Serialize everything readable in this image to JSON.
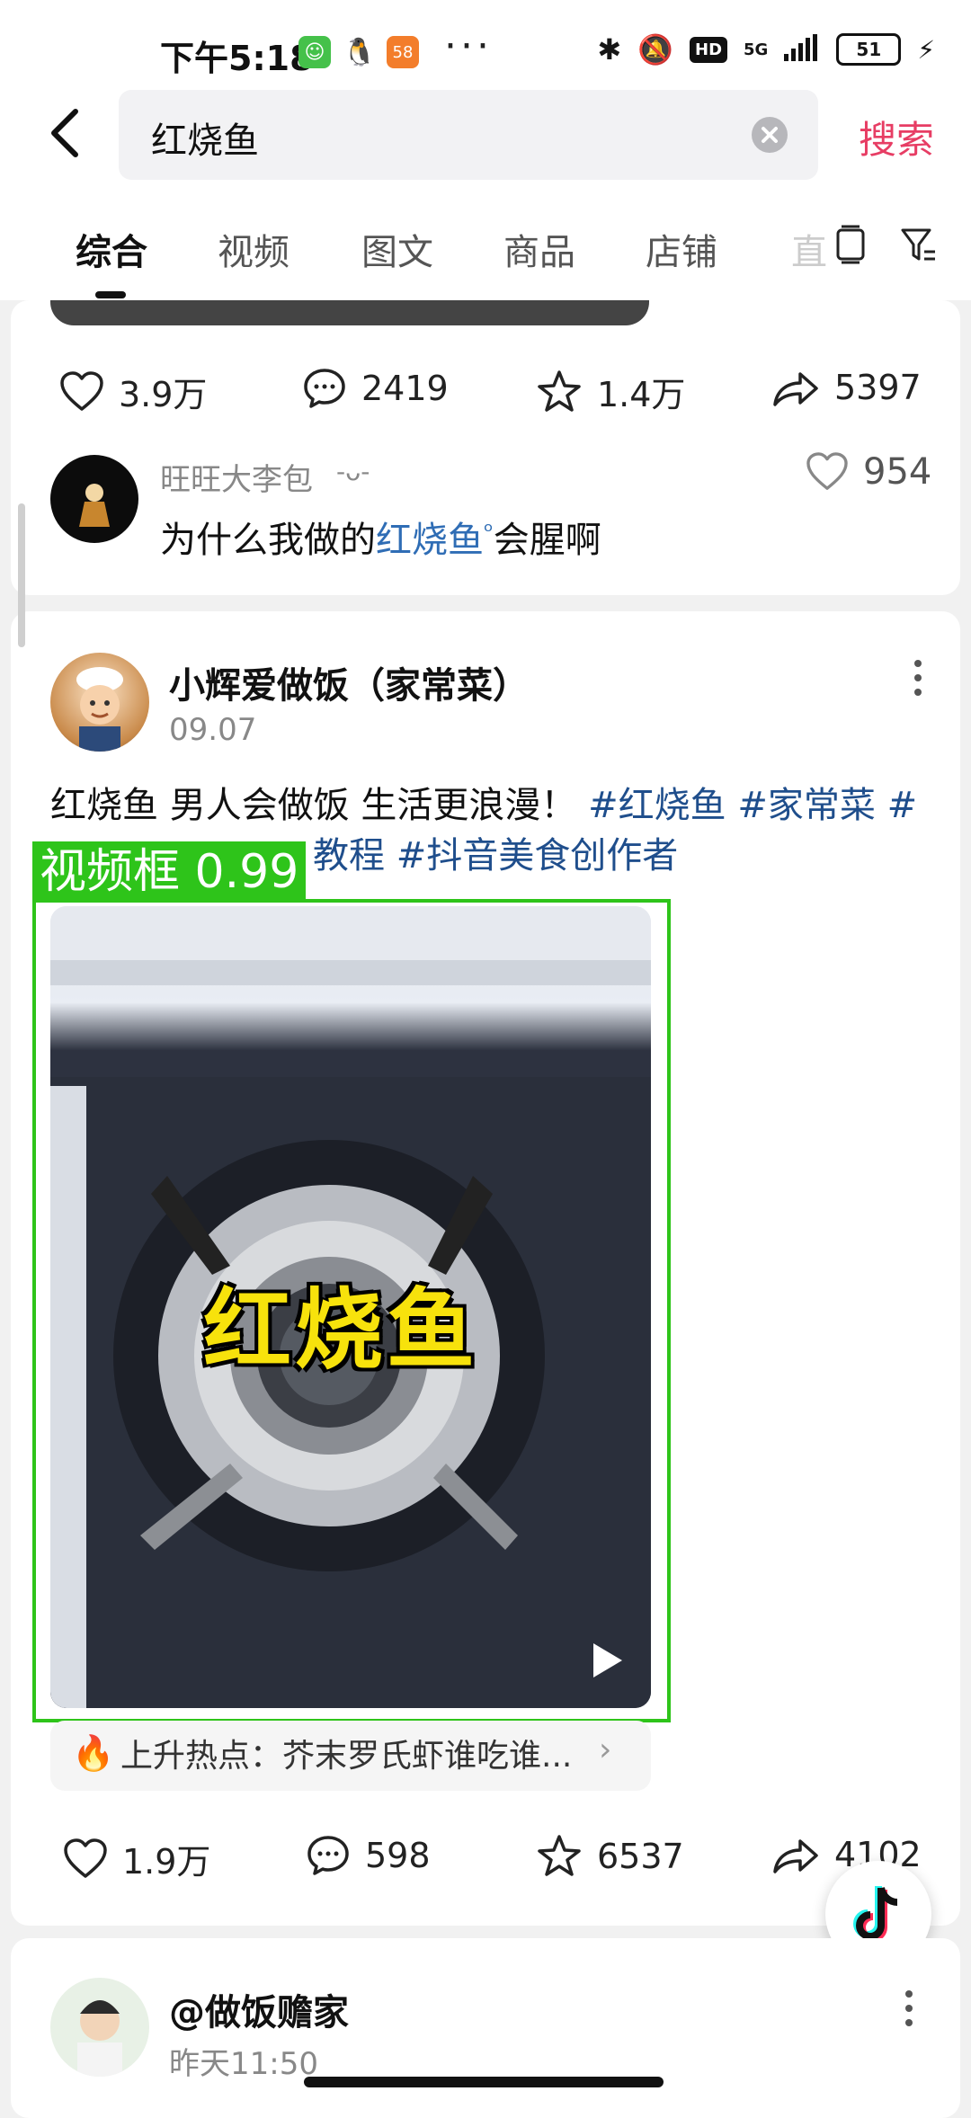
{
  "status_bar": {
    "time": "下午5:18",
    "notif_icons": [
      "wechat-icon",
      "qq-penguin-icon",
      "58-app-icon"
    ],
    "more": "···",
    "network": "5G",
    "hd": "HD",
    "battery": "51"
  },
  "search": {
    "query": "红烧鱼",
    "button": "搜索"
  },
  "tabs": {
    "items": [
      "综合",
      "视频",
      "图文",
      "商品",
      "店铺"
    ],
    "overflow_partial": "直"
  },
  "post1": {
    "stats": {
      "likes": "3.9万",
      "comments": "2419",
      "favorites": "1.4万",
      "shares": "5397"
    },
    "top_comment": {
      "user": "旺旺大李包",
      "emote": "-ᴗ-",
      "text_before": "为什么我做的",
      "keyword": "红烧鱼",
      "text_after": "会腥啊",
      "likes": "954"
    }
  },
  "post2": {
    "author": "小辉爱做饭（家常菜）",
    "date": "09.07",
    "text_line1_plain": "红烧鱼 男人会做饭 生活更浪漫！",
    "text_line1_tags": " #红烧鱼 #家常菜 #",
    "text_line2_tags": "教程 #抖音美食创作者",
    "video_overlay_title": "红烧鱼",
    "detection_label": "视频框 0.99",
    "hot_topic": "上升热点：芥末罗氏虾谁吃谁...",
    "stats": {
      "likes": "1.9万",
      "comments": "598",
      "favorites": "6537",
      "shares": "4102"
    }
  },
  "post3": {
    "author": "@做饭赡家",
    "date": "昨天11:50"
  },
  "colors": {
    "accent": "#e73d64",
    "hashtag": "#1f4e8c",
    "detection": "#2ec41a",
    "video_title": "#f7e20c"
  }
}
